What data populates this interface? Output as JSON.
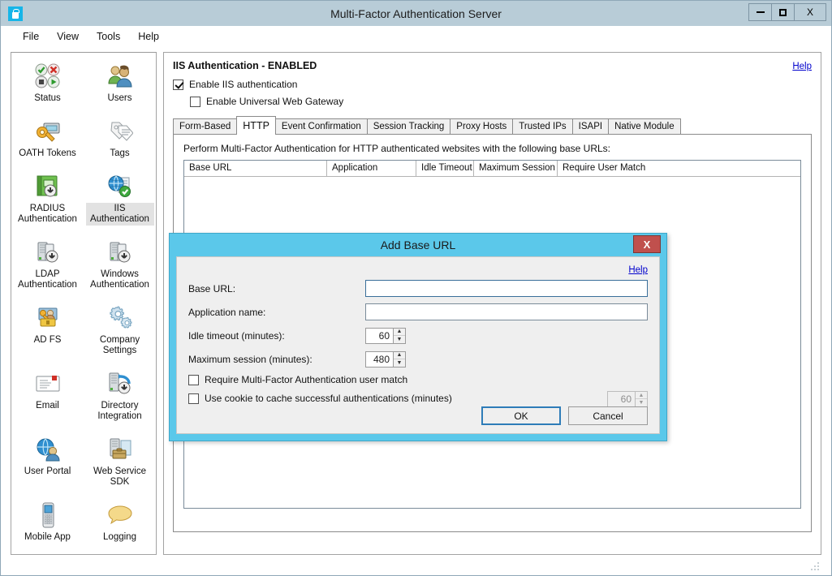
{
  "window": {
    "title": "Multi-Factor Authentication Server",
    "app_icon": "lock-icon",
    "controls": {
      "minimize": "minimize-icon",
      "maximize": "maximize-icon",
      "close": "X"
    }
  },
  "menu": {
    "items": [
      "File",
      "View",
      "Tools",
      "Help"
    ]
  },
  "sidebar": {
    "items": [
      {
        "label": "Status",
        "icon": "status-icon",
        "selected": false
      },
      {
        "label": "Users",
        "icon": "users-icon",
        "selected": false
      },
      {
        "label": "OATH Tokens",
        "icon": "oath-tokens-icon",
        "selected": false
      },
      {
        "label": "Tags",
        "icon": "tags-icon",
        "selected": false
      },
      {
        "label": "RADIUS Authentication",
        "icon": "radius-icon",
        "selected": false
      },
      {
        "label": "IIS Authentication",
        "icon": "iis-icon",
        "selected": true
      },
      {
        "label": "LDAP Authentication",
        "icon": "ldap-icon",
        "selected": false
      },
      {
        "label": "Windows Authentication",
        "icon": "windows-auth-icon",
        "selected": false
      },
      {
        "label": "AD FS",
        "icon": "adfs-icon",
        "selected": false
      },
      {
        "label": "Company Settings",
        "icon": "company-settings-icon",
        "selected": false
      },
      {
        "label": "Email",
        "icon": "email-icon",
        "selected": false
      },
      {
        "label": "Directory Integration",
        "icon": "directory-integration-icon",
        "selected": false
      },
      {
        "label": "User Portal",
        "icon": "user-portal-icon",
        "selected": false
      },
      {
        "label": "Web Service SDK",
        "icon": "web-service-sdk-icon",
        "selected": false
      },
      {
        "label": "Mobile App",
        "icon": "mobile-app-icon",
        "selected": false
      },
      {
        "label": "Logging",
        "icon": "logging-icon",
        "selected": false
      }
    ]
  },
  "main": {
    "title": "IIS Authentication - ENABLED",
    "help_label": "Help",
    "checkboxes": [
      {
        "label": "Enable IIS authentication",
        "checked": true
      },
      {
        "label": "Enable Universal Web Gateway",
        "checked": false
      }
    ],
    "tabs": [
      {
        "label": "Form-Based",
        "active": false
      },
      {
        "label": "HTTP",
        "active": true
      },
      {
        "label": "Event Confirmation",
        "active": false
      },
      {
        "label": "Session Tracking",
        "active": false
      },
      {
        "label": "Proxy Hosts",
        "active": false
      },
      {
        "label": "Trusted IPs",
        "active": false
      },
      {
        "label": "ISAPI",
        "active": false
      },
      {
        "label": "Native Module",
        "active": false
      }
    ],
    "instruction": "Perform Multi-Factor Authentication for HTTP authenticated websites with the following base URLs:",
    "table": {
      "columns": [
        "Base URL",
        "Application",
        "Idle Timeout",
        "Maximum Session",
        "Require User Match"
      ],
      "rows": []
    }
  },
  "dialog": {
    "title": "Add Base URL",
    "close_label": "X",
    "help_label": "Help",
    "fields": [
      {
        "label": "Base URL:",
        "value": "",
        "placeholder": ""
      },
      {
        "label": "Application name:",
        "value": "",
        "placeholder": ""
      }
    ],
    "spinners": [
      {
        "label": "Idle timeout (minutes):",
        "value": "60",
        "disabled": false
      },
      {
        "label": "Maximum session (minutes):",
        "value": "480",
        "disabled": false
      }
    ],
    "checkboxes": [
      {
        "label": "Require Multi-Factor Authentication user match",
        "checked": false
      },
      {
        "label": "Use cookie to cache successful authentications (minutes)",
        "checked": false
      }
    ],
    "cookie_spinner": {
      "value": "60",
      "disabled": true
    },
    "buttons": [
      {
        "label": "OK",
        "default": true
      },
      {
        "label": "Cancel",
        "default": false
      }
    ]
  },
  "colors": {
    "title_bar": "#b8ccd7",
    "dialog_accent": "#5bc8ea",
    "close_button": "#c0504d",
    "link": "#0000cc",
    "selection": "#e2e2e2"
  }
}
